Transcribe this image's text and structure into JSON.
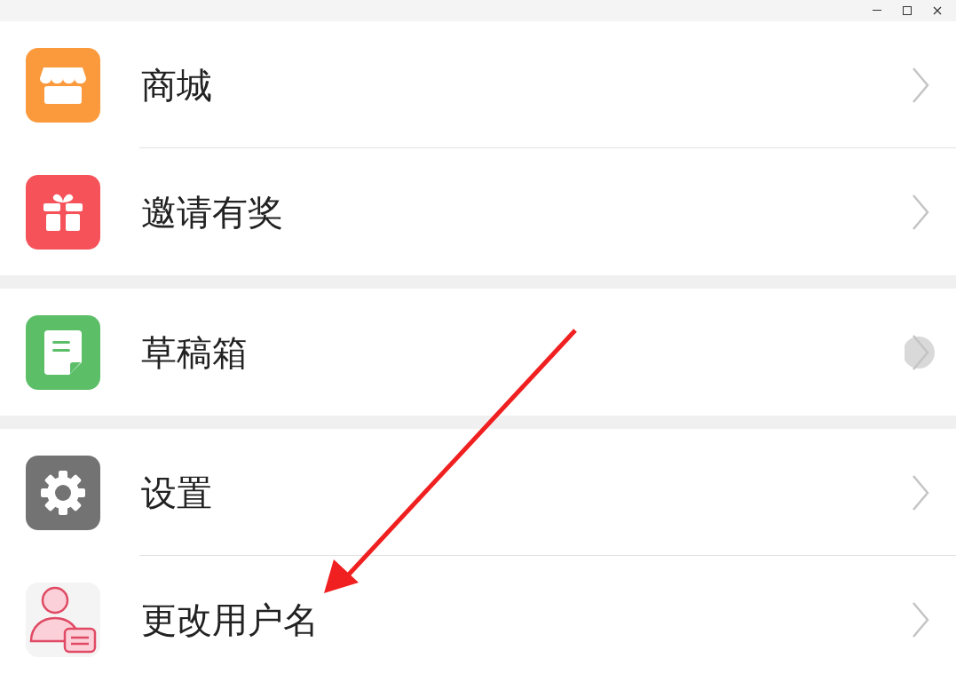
{
  "window": {
    "controls": [
      {
        "kind": "minimize"
      },
      {
        "kind": "maximize"
      },
      {
        "kind": "close"
      }
    ]
  },
  "sections": [
    {
      "items": [
        {
          "label": "商城",
          "kind": "store",
          "pressed": false
        },
        {
          "label": "邀请有奖",
          "kind": "gift",
          "pressed": false
        }
      ]
    },
    {
      "items": [
        {
          "label": "草稿箱",
          "kind": "draft",
          "pressed": true
        }
      ]
    },
    {
      "items": [
        {
          "label": "设置",
          "kind": "settings",
          "pressed": false
        },
        {
          "label": "更改用户名",
          "kind": "user",
          "pressed": false
        }
      ]
    }
  ]
}
